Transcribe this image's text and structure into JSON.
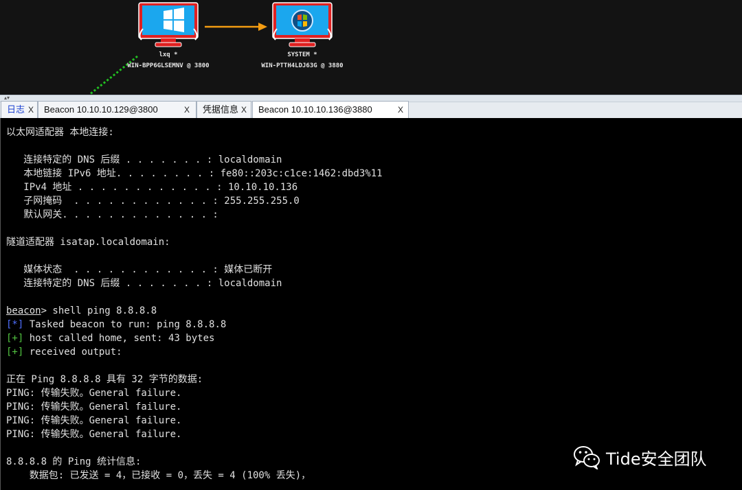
{
  "graph": {
    "nodes": [
      {
        "label": "lxq *",
        "host": "WIN-BPP6GLSEMNV @ 3800",
        "os": "windows-10"
      },
      {
        "label": "SYSTEM *",
        "host": "WIN-PTTH4LDJ63G @ 3880",
        "os": "windows-7"
      }
    ],
    "colors": {
      "link": "#f39c12",
      "pivot": "#22c022",
      "frame": "#e02020",
      "screen": "#1ba7ee"
    }
  },
  "tabs": [
    {
      "label": "日志",
      "close": "X"
    },
    {
      "label": "Beacon 10.10.10.129@3800",
      "close": "X"
    },
    {
      "label": "凭据信息",
      "close": "X"
    },
    {
      "label": "Beacon 10.10.10.136@3880",
      "close": "X"
    }
  ],
  "console": {
    "lines": [
      {
        "text": "以太网适配器 本地连接:"
      },
      {
        "text": ""
      },
      {
        "text": "   连接特定的 DNS 后缀 . . . . . . . : localdomain"
      },
      {
        "text": "   本地链接 IPv6 地址. . . . . . . . : fe80::203c:c1ce:1462:dbd3%11"
      },
      {
        "text": "   IPv4 地址 . . . . . . . . . . . . : 10.10.10.136"
      },
      {
        "text": "   子网掩码  . . . . . . . . . . . . : 255.255.255.0"
      },
      {
        "text": "   默认网关. . . . . . . . . . . . . :"
      },
      {
        "text": ""
      },
      {
        "text": "隧道适配器 isatap.localdomain:"
      },
      {
        "text": ""
      },
      {
        "text": "   媒体状态  . . . . . . . . . . . . : 媒体已断开"
      },
      {
        "text": "   连接特定的 DNS 后缀 . . . . . . . : localdomain"
      },
      {
        "text": ""
      },
      {
        "prompt": "beacon",
        "text": "> shell ping 8.8.8.8"
      },
      {
        "marker": "[*]",
        "kind": "blue",
        "text": " Tasked beacon to run: ping 8.8.8.8"
      },
      {
        "marker": "[+]",
        "kind": "green",
        "text": " host called home, sent: 43 bytes"
      },
      {
        "marker": "[+]",
        "kind": "green",
        "text": " received output:"
      },
      {
        "text": ""
      },
      {
        "text": "正在 Ping 8.8.8.8 具有 32 字节的数据:"
      },
      {
        "text": "PING: 传输失败。General failure."
      },
      {
        "text": "PING: 传输失败。General failure."
      },
      {
        "text": "PING: 传输失败。General failure."
      },
      {
        "text": "PING: 传输失败。General failure."
      },
      {
        "text": ""
      },
      {
        "text": "8.8.8.8 的 Ping 统计信息:"
      },
      {
        "text": "    数据包: 已发送 = 4，已接收 = 0，丢失 = 4 (100% 丢失)，"
      }
    ]
  },
  "watermark": {
    "text": "Tide安全团队",
    "icon": "wechat-icon"
  }
}
